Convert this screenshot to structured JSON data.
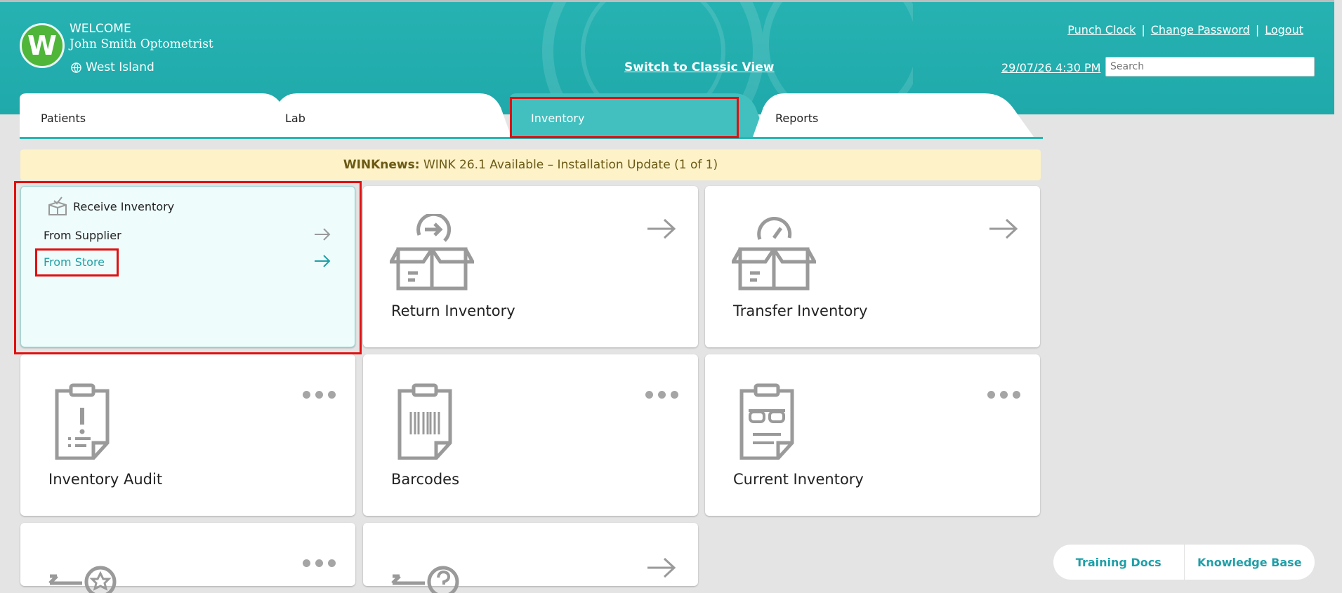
{
  "header": {
    "welcome_label": "WELCOME",
    "user_name": "John Smith Optometrist",
    "location": "West Island",
    "switch_view": "Switch to Classic View",
    "links": [
      "Punch Clock",
      "Change Password",
      "Logout"
    ],
    "link_separator": "|",
    "datetime": "29/07/26 4:30 PM",
    "search_placeholder": "Search",
    "logo_letter": "W"
  },
  "tabs": [
    {
      "label": "Patients",
      "active": false
    },
    {
      "label": "Lab",
      "active": false
    },
    {
      "label": "Inventory",
      "active": true
    },
    {
      "label": "Reports",
      "active": false
    }
  ],
  "news": {
    "prefix": "WINKnews:",
    "text": "WINK 26.1 Available – Installation Update (1 of 1)"
  },
  "receive_card": {
    "title": "Receive Inventory",
    "items": [
      {
        "label": "From Supplier",
        "highlighted": false
      },
      {
        "label": "From Store",
        "highlighted": true
      }
    ]
  },
  "cards": [
    {
      "title": "Return Inventory",
      "icon": "box-return-icon",
      "action": "arrow"
    },
    {
      "title": "Transfer Inventory",
      "icon": "box-transfer-icon",
      "action": "arrow"
    },
    {
      "title": "Inventory Audit",
      "icon": "clipboard-audit-icon",
      "action": "more"
    },
    {
      "title": "Barcodes",
      "icon": "clipboard-barcode-icon",
      "action": "more"
    },
    {
      "title": "Current Inventory",
      "icon": "clipboard-glasses-icon",
      "action": "more"
    }
  ],
  "help": {
    "training": "Training Docs",
    "knowledge": "Knowledge Base"
  },
  "colors": {
    "brand": "#27b2b2",
    "accent_text": "#1fa0a6",
    "highlight": "#e01010",
    "news_bg": "#fdf2c8",
    "logo_green": "#4fb63a"
  }
}
